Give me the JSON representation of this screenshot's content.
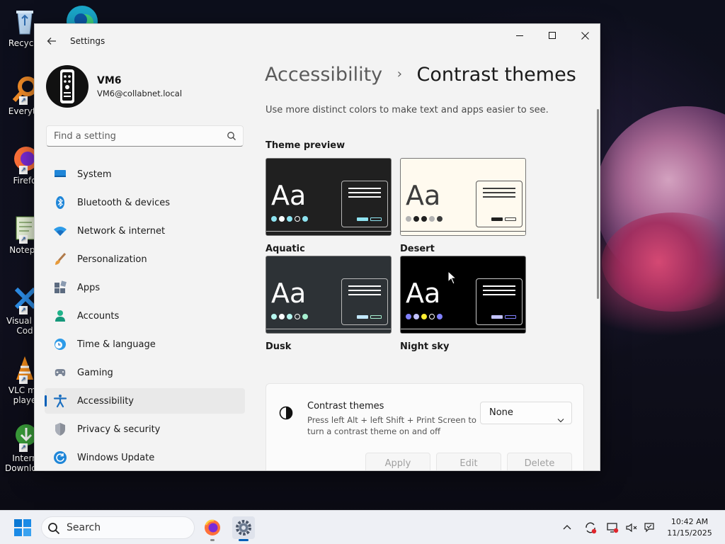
{
  "window": {
    "title": "Settings",
    "controls": {
      "minimize": "—",
      "maximize": "☐",
      "close": "✕"
    }
  },
  "profile": {
    "name": "VM6",
    "email": "VM6@collabnet.local"
  },
  "search": {
    "placeholder": "Find a setting"
  },
  "nav": {
    "items": [
      {
        "label": "System",
        "icon": "monitor-icon"
      },
      {
        "label": "Bluetooth & devices",
        "icon": "bluetooth-icon"
      },
      {
        "label": "Network & internet",
        "icon": "wifi-icon"
      },
      {
        "label": "Personalization",
        "icon": "brush-icon"
      },
      {
        "label": "Apps",
        "icon": "apps-icon"
      },
      {
        "label": "Accounts",
        "icon": "person-icon"
      },
      {
        "label": "Time & language",
        "icon": "globe-clock-icon"
      },
      {
        "label": "Gaming",
        "icon": "gamepad-icon"
      },
      {
        "label": "Accessibility",
        "icon": "accessibility-icon",
        "active": true
      },
      {
        "label": "Privacy & security",
        "icon": "shield-icon"
      },
      {
        "label": "Windows Update",
        "icon": "update-icon"
      }
    ]
  },
  "main": {
    "breadcrumb": {
      "parent": "Accessibility",
      "separator": "›",
      "current": "Contrast themes"
    },
    "subtitle": "Use more distinct colors to make text and apps easier to see.",
    "preview_heading": "Theme preview",
    "preview_sample": "Aa",
    "themes": [
      {
        "name": "Aquatic",
        "bg": "#202020",
        "fg": "#ffffff",
        "dots": [
          "#8ee3f0",
          "#ffffff",
          "#8ee3f0",
          "#202020",
          "#8ee3f0"
        ],
        "accent": "#8ee3f0"
      },
      {
        "name": "Desert",
        "bg": "#fffaef",
        "fg": "#3d3d3d",
        "dots": [
          "#b3b3b3",
          "#202020",
          "#202020",
          "#b3b3b3",
          "#3d3d3d"
        ],
        "accent": "#202020"
      },
      {
        "name": "Dusk",
        "bg": "#2d3236",
        "fg": "#ffffff",
        "dots": [
          "#b6f6f0",
          "#ffffff",
          "#b6f6f0",
          "#2d3236",
          "#a6f0d0"
        ],
        "accent": "#c2e8ff"
      },
      {
        "name": "Night sky",
        "bg": "#000000",
        "fg": "#ffffff",
        "dots": [
          "#8080ff",
          "#c2c2ff",
          "#ffee32",
          "#000000",
          "#8080ff"
        ],
        "accent": "#c2c2ff"
      }
    ],
    "contrast_card": {
      "title": "Contrast themes",
      "description": "Press left Alt + left Shift + Print Screen to turn a contrast theme on and off",
      "selected": "None",
      "buttons": {
        "apply": "Apply",
        "edit": "Edit",
        "delete": "Delete"
      }
    }
  },
  "desktop": {
    "icons": [
      "Recycle",
      "Everyth",
      "Firefo",
      "Notepa",
      "Visual St Cod",
      "VLC me playe",
      "Intern Downlo..."
    ]
  },
  "taskbar": {
    "search_label": "Search",
    "time": "10:42 AM",
    "date": "11/15/2025"
  }
}
